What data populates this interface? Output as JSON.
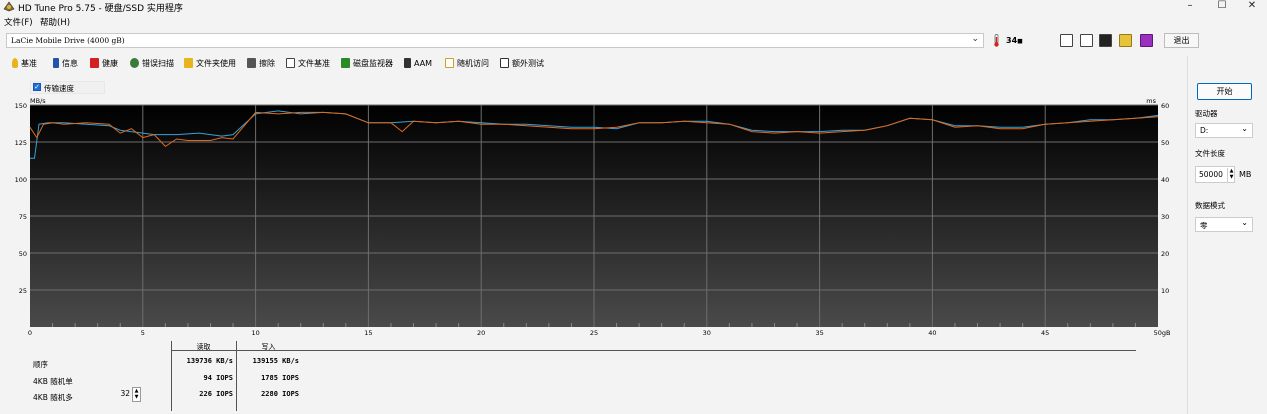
{
  "window": {
    "title": "HD Tune Pro 5.75 - 硬盘/SSD 实用程序",
    "minimize": "–",
    "maximize": "☐",
    "close": "✕"
  },
  "menu": {
    "file": "文件(F)",
    "help": "帮助(H)"
  },
  "drivebar": {
    "drive": "LaCie  Mobile Drive (4000 gB)",
    "temperature": "34",
    "exit_label": "退出"
  },
  "tabs": [
    {
      "label": "基准",
      "icon": "bulb-icon",
      "color": "#e7b51b"
    },
    {
      "label": "信息",
      "icon": "info-icon",
      "color": "#2255aa"
    },
    {
      "label": "健康",
      "icon": "health-cross-icon",
      "color": "#d42020"
    },
    {
      "label": "错误扫描",
      "icon": "magnifier-icon",
      "color": "#3a7a3a"
    },
    {
      "label": "文件夹使用",
      "icon": "folder-icon",
      "color": "#e7b51b"
    },
    {
      "label": "擦除",
      "icon": "trash-icon",
      "color": "#555555"
    },
    {
      "label": "文件基准",
      "icon": "file-benchmark-icon",
      "color": "#444444"
    },
    {
      "label": "磁盘监视器",
      "icon": "disk-monitor-icon",
      "color": "#2a8a2a"
    },
    {
      "label": "AAM",
      "icon": "speaker-icon",
      "color": "#333333"
    },
    {
      "label": "随机访问",
      "icon": "random-access-icon",
      "color": "#d0a020"
    },
    {
      "label": "额外测试",
      "icon": "extra-tests-icon",
      "color": "#333333"
    }
  ],
  "chart_toggle": {
    "label": "传输速度",
    "checked": true
  },
  "chart_data": {
    "type": "line",
    "ylabel": "MB/s",
    "y2label": "ms",
    "xlabel": "gB",
    "xlim": [
      0,
      50
    ],
    "ylim": [
      0,
      150
    ],
    "y2lim": [
      0,
      60
    ],
    "x_ticks": [
      "0",
      "5",
      "10",
      "15",
      "20",
      "25",
      "30",
      "35",
      "40",
      "45",
      "50gB"
    ],
    "y_ticks": [
      "150",
      "125",
      "100",
      "75",
      "50",
      "25"
    ],
    "y2_ticks": [
      "60",
      "50",
      "40",
      "30",
      "20",
      "10"
    ],
    "grid": true,
    "series": [
      {
        "color": "#3aa0d8",
        "x": [
          0,
          0.2,
          0.4,
          0.8,
          1.5,
          2.5,
          3.5,
          4.0,
          5.0,
          5.5,
          6.5,
          7.5,
          8.5,
          9.0,
          10.0,
          11.0,
          12.0,
          13.0,
          14.0,
          15.0,
          16.0,
          17.0,
          18.0,
          19.0,
          20.0,
          21.0,
          22.0,
          23.0,
          24.0,
          25.0,
          26.0,
          27.0,
          28.0,
          29.0,
          30.0,
          31.0,
          32.0,
          33.0,
          34.0,
          35.0,
          36.0,
          37.0,
          38.0,
          39.0,
          40.0,
          41.0,
          42.0,
          43.0,
          44.0,
          45.0,
          46.0,
          47.0,
          48.0,
          49.0,
          50.0
        ],
        "values": [
          114,
          114,
          137,
          138,
          138,
          137,
          136,
          133,
          131,
          130,
          130,
          131,
          129,
          130,
          144,
          146,
          144,
          145,
          144,
          138,
          138,
          139,
          138,
          139,
          138,
          137,
          137,
          136,
          135,
          135,
          134,
          138,
          138,
          139,
          139,
          137,
          133,
          132,
          132,
          132,
          133,
          133,
          136,
          141,
          140,
          136,
          136,
          135,
          135,
          137,
          138,
          140,
          140,
          141,
          143
        ]
      },
      {
        "color": "#e06a1c",
        "x": [
          0,
          0.3,
          0.6,
          1.0,
          1.5,
          2.5,
          3.5,
          4.0,
          4.5,
          5.0,
          5.5,
          6.0,
          6.5,
          7.0,
          8.0,
          8.5,
          9.0,
          10.0,
          11.0,
          12.0,
          13.0,
          14.0,
          15.0,
          16.0,
          16.5,
          17.0,
          18.0,
          19.0,
          20.0,
          21.0,
          22.0,
          23.0,
          24.0,
          25.0,
          26.0,
          27.0,
          28.0,
          29.0,
          30.0,
          31.0,
          32.0,
          33.0,
          34.0,
          35.0,
          36.0,
          37.0,
          38.0,
          39.0,
          40.0,
          41.0,
          42.0,
          43.0,
          44.0,
          45.0,
          46.0,
          47.0,
          48.0,
          49.0,
          50.0
        ],
        "values": [
          135,
          128,
          137,
          138,
          137,
          138,
          137,
          131,
          134,
          128,
          130,
          122,
          127,
          126,
          126,
          128,
          127,
          145,
          144,
          145,
          145,
          144,
          138,
          138,
          132,
          139,
          138,
          139,
          137,
          137,
          136,
          135,
          134,
          134,
          135,
          138,
          138,
          139,
          138,
          137,
          132,
          131,
          132,
          131,
          132,
          133,
          136,
          141,
          140,
          135,
          136,
          134,
          134,
          137,
          138,
          139,
          140,
          141,
          142
        ]
      }
    ]
  },
  "stats": {
    "read_header": "读取",
    "write_header": "写入",
    "rows": [
      {
        "label": "顺序",
        "read": "139736 KB/s",
        "write": "139155 KB/s"
      },
      {
        "label": "4KB 随机单",
        "read": "94 IOPS",
        "write": "1785 IOPS"
      },
      {
        "label": "4KB 随机多",
        "read": "226 IOPS",
        "write": "2280 IOPS"
      }
    ],
    "queue_depth": "32"
  },
  "side": {
    "start_label": "开始",
    "drive_label": "驱动器",
    "drive_value": "D:",
    "filesize_label": "文件长度",
    "filesize_value": "50000",
    "filesize_unit": "MB",
    "pattern_label": "数据模式",
    "pattern_value": "零"
  }
}
